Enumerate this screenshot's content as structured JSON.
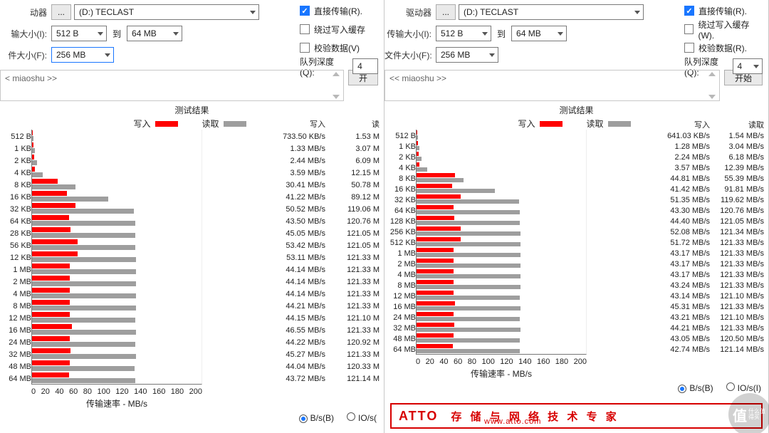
{
  "groups": {
    "drive": {
      "label_left": "动器",
      "label_right": "驱动器",
      "btn": "...",
      "value": "(D:) TECLAST"
    },
    "xfer": {
      "label_left": "输大小(I):",
      "label_right": "传输大小(I):",
      "from": "512 B",
      "to_label": "到",
      "to": "64 MB"
    },
    "fsize": {
      "label_left": "件大小(F):",
      "label_right": "文件大小(F):",
      "value": "256 MB"
    },
    "direct": {
      "label": "直接传输(R)."
    },
    "bypass_l": {
      "label": "绕过写入缓存"
    },
    "bypass_r": {
      "label": "绕过写入缓存(W)."
    },
    "verify": {
      "label_left": "校验数据(V)",
      "label_right": "校验数据(R)."
    },
    "queue": {
      "label": "队列深度(Q):",
      "value": "4"
    }
  },
  "comment_text": "< miaoshu >>",
  "comment_text_r": "<< miaoshu >>",
  "start_button": {
    "left": "开",
    "right": "开始"
  },
  "legend": {
    "title": "测试结果",
    "write": "写入",
    "read": "读取"
  },
  "numhead": {
    "write": "写入",
    "read_l": "读",
    "read_r": "读取"
  },
  "radios": {
    "bs": "B/s(B)",
    "ios": "IO/s(I)"
  },
  "axis": {
    "xlabel": "传输速率 - MB/s",
    "max": 200
  },
  "ad": {
    "brand": "ATTO",
    "slogan": "存 储 与 网 络 技 术 专 家",
    "url": "www.atto.com"
  },
  "watermark": {
    "big": "值",
    "small": "什么值得买"
  },
  "chart_data": [
    {
      "type": "bar",
      "title": "测试结果",
      "xlabel": "传输速率 - MB/s",
      "ylabel": "",
      "xlim": [
        0,
        200
      ],
      "series_names": [
        "写入",
        "读取"
      ],
      "rows": [
        {
          "size": "512 B",
          "write_txt": "733.50 KB/s",
          "read_txt": "1.53 M",
          "write_mb": 0.73,
          "read_mb": 1.53
        },
        {
          "size": "1 KB",
          "write_txt": "1.33 MB/s",
          "read_txt": "3.07 M",
          "write_mb": 1.33,
          "read_mb": 3.07
        },
        {
          "size": "2 KB",
          "write_txt": "2.44 MB/s",
          "read_txt": "6.09 M",
          "write_mb": 2.44,
          "read_mb": 6.09
        },
        {
          "size": "4 KB",
          "write_txt": "3.59 MB/s",
          "read_txt": "12.15 M",
          "write_mb": 3.59,
          "read_mb": 12.15
        },
        {
          "size": "8 KB",
          "write_txt": "30.41 MB/s",
          "read_txt": "50.78 M",
          "write_mb": 30.41,
          "read_mb": 50.78
        },
        {
          "size": "16 KB",
          "write_txt": "41.22 MB/s",
          "read_txt": "89.12 M",
          "write_mb": 41.22,
          "read_mb": 89.12
        },
        {
          "size": "32 KB",
          "write_txt": "50.52 MB/s",
          "read_txt": "119.06 M",
          "write_mb": 50.52,
          "read_mb": 119.06
        },
        {
          "size": "64 KB",
          "write_txt": "43.50 MB/s",
          "read_txt": "120.76 M",
          "write_mb": 43.5,
          "read_mb": 120.76
        },
        {
          "size": "28 KB",
          "write_txt": "45.05 MB/s",
          "read_txt": "121.05 M",
          "write_mb": 45.05,
          "read_mb": 121.05
        },
        {
          "size": "56 KB",
          "write_txt": "53.42 MB/s",
          "read_txt": "121.05 M",
          "write_mb": 53.42,
          "read_mb": 121.05
        },
        {
          "size": "12 KB",
          "write_txt": "53.11 MB/s",
          "read_txt": "121.33 M",
          "write_mb": 53.11,
          "read_mb": 121.33
        },
        {
          "size": "1 MB",
          "write_txt": "44.14 MB/s",
          "read_txt": "121.33 M",
          "write_mb": 44.14,
          "read_mb": 121.33
        },
        {
          "size": "2 MB",
          "write_txt": "44.14 MB/s",
          "read_txt": "121.33 M",
          "write_mb": 44.14,
          "read_mb": 121.33
        },
        {
          "size": "4 MB",
          "write_txt": "44.14 MB/s",
          "read_txt": "121.33 M",
          "write_mb": 44.14,
          "read_mb": 121.33
        },
        {
          "size": "8 MB",
          "write_txt": "44.21 MB/s",
          "read_txt": "121.33 M",
          "write_mb": 44.21,
          "read_mb": 121.33
        },
        {
          "size": "12 MB",
          "write_txt": "44.15 MB/s",
          "read_txt": "121.10 M",
          "write_mb": 44.15,
          "read_mb": 121.1
        },
        {
          "size": "16 MB",
          "write_txt": "46.55 MB/s",
          "read_txt": "121.33 M",
          "write_mb": 46.55,
          "read_mb": 121.33
        },
        {
          "size": "24 MB",
          "write_txt": "44.22 MB/s",
          "read_txt": "120.92 M",
          "write_mb": 44.22,
          "read_mb": 120.92
        },
        {
          "size": "32 MB",
          "write_txt": "45.27 MB/s",
          "read_txt": "121.33 M",
          "write_mb": 45.27,
          "read_mb": 121.33
        },
        {
          "size": "48 MB",
          "write_txt": "44.04 MB/s",
          "read_txt": "120.33 M",
          "write_mb": 44.04,
          "read_mb": 120.33
        },
        {
          "size": "64 MB",
          "write_txt": "43.72 MB/s",
          "read_txt": "121.14 M",
          "write_mb": 43.72,
          "read_mb": 121.14
        }
      ]
    },
    {
      "type": "bar",
      "title": "测试结果",
      "xlabel": "传输速率 - MB/s",
      "ylabel": "",
      "xlim": [
        0,
        200
      ],
      "series_names": [
        "写入",
        "读取"
      ],
      "rows": [
        {
          "size": "512 B",
          "write_txt": "641.03 KB/s",
          "read_txt": "1.54 MB/s",
          "write_mb": 0.64,
          "read_mb": 1.54
        },
        {
          "size": "1 KB",
          "write_txt": "1.28 MB/s",
          "read_txt": "3.04 MB/s",
          "write_mb": 1.28,
          "read_mb": 3.04
        },
        {
          "size": "2 KB",
          "write_txt": "2.24 MB/s",
          "read_txt": "6.18 MB/s",
          "write_mb": 2.24,
          "read_mb": 6.18
        },
        {
          "size": "4 KB",
          "write_txt": "3.57 MB/s",
          "read_txt": "12.39 MB/s",
          "write_mb": 3.57,
          "read_mb": 12.39
        },
        {
          "size": "8 KB",
          "write_txt": "44.81 MB/s",
          "read_txt": "55.39 MB/s",
          "write_mb": 44.81,
          "read_mb": 55.39
        },
        {
          "size": "16 KB",
          "write_txt": "41.42 MB/s",
          "read_txt": "91.81 MB/s",
          "write_mb": 41.42,
          "read_mb": 91.81
        },
        {
          "size": "32 KB",
          "write_txt": "51.35 MB/s",
          "read_txt": "119.62 MB/s",
          "write_mb": 51.35,
          "read_mb": 119.62
        },
        {
          "size": "64 KB",
          "write_txt": "43.30 MB/s",
          "read_txt": "120.76 MB/s",
          "write_mb": 43.3,
          "read_mb": 120.76
        },
        {
          "size": "128 KB",
          "write_txt": "44.40 MB/s",
          "read_txt": "121.05 MB/s",
          "write_mb": 44.4,
          "read_mb": 121.05
        },
        {
          "size": "256 KB",
          "write_txt": "52.08 MB/s",
          "read_txt": "121.34 MB/s",
          "write_mb": 52.08,
          "read_mb": 121.34
        },
        {
          "size": "512 KB",
          "write_txt": "51.72 MB/s",
          "read_txt": "121.33 MB/s",
          "write_mb": 51.72,
          "read_mb": 121.33
        },
        {
          "size": "1 MB",
          "write_txt": "43.17 MB/s",
          "read_txt": "121.33 MB/s",
          "write_mb": 43.17,
          "read_mb": 121.33
        },
        {
          "size": "2 MB",
          "write_txt": "43.17 MB/s",
          "read_txt": "121.33 MB/s",
          "write_mb": 43.17,
          "read_mb": 121.33
        },
        {
          "size": "4 MB",
          "write_txt": "43.17 MB/s",
          "read_txt": "121.33 MB/s",
          "write_mb": 43.17,
          "read_mb": 121.33
        },
        {
          "size": "8 MB",
          "write_txt": "43.24 MB/s",
          "read_txt": "121.33 MB/s",
          "write_mb": 43.24,
          "read_mb": 121.33
        },
        {
          "size": "12 MB",
          "write_txt": "43.14 MB/s",
          "read_txt": "121.10 MB/s",
          "write_mb": 43.14,
          "read_mb": 121.1
        },
        {
          "size": "16 MB",
          "write_txt": "45.31 MB/s",
          "read_txt": "121.33 MB/s",
          "write_mb": 45.31,
          "read_mb": 121.33
        },
        {
          "size": "24 MB",
          "write_txt": "43.21 MB/s",
          "read_txt": "121.10 MB/s",
          "write_mb": 43.21,
          "read_mb": 121.1
        },
        {
          "size": "32 MB",
          "write_txt": "44.21 MB/s",
          "read_txt": "121.33 MB/s",
          "write_mb": 44.21,
          "read_mb": 121.33
        },
        {
          "size": "48 MB",
          "write_txt": "43.05 MB/s",
          "read_txt": "120.50 MB/s",
          "write_mb": 43.05,
          "read_mb": 120.5
        },
        {
          "size": "64 MB",
          "write_txt": "42.74 MB/s",
          "read_txt": "121.14 MB/s",
          "write_mb": 42.74,
          "read_mb": 121.14
        }
      ]
    }
  ]
}
